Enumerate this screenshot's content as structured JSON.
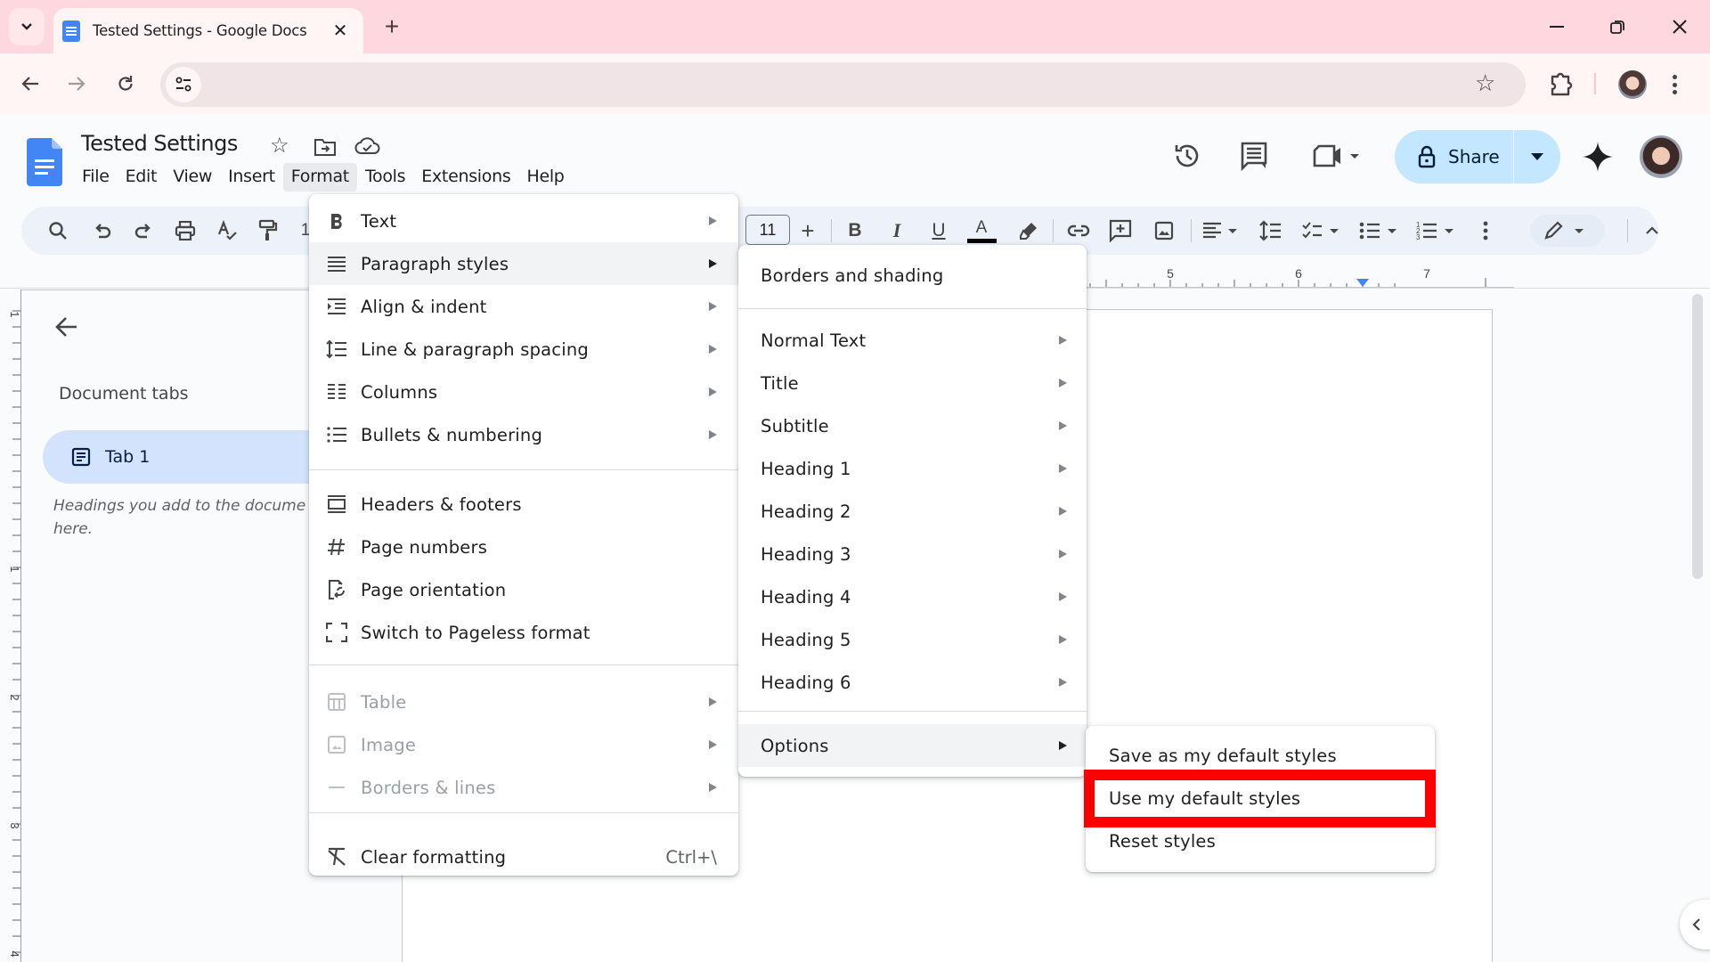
{
  "browser": {
    "tab_title": "Tested Settings - Google Docs",
    "icons": {
      "tab_search": "chevron-down-icon",
      "close_tab": "close-icon",
      "new_tab": "plus-icon",
      "minimize": "minimize-icon",
      "restore": "restore-icon",
      "close_window": "close-icon",
      "back": "arrow-left-icon",
      "forward": "arrow-right-icon",
      "reload": "reload-icon",
      "site_info": "tune-icon",
      "bookmark": "star-icon",
      "extensions": "puzzle-icon",
      "profile": "avatar",
      "menu": "more-vert-icon"
    },
    "glyphs": {
      "chevron": "⌄",
      "close": "✕",
      "plus": "+",
      "minimize": "—",
      "restore": "❐",
      "back": "←",
      "forward": "→",
      "reload": "↻",
      "star": "☆"
    },
    "address": ""
  },
  "docs": {
    "title": "Tested Settings",
    "title_glyphs": {
      "star": "☆"
    },
    "menubar": [
      "File",
      "Edit",
      "View",
      "Insert",
      "Format",
      "Tools",
      "Extensions",
      "Help"
    ],
    "active_menu": "Format",
    "header_actions": {
      "history": "history-icon",
      "comments": "comment-icon",
      "meet": "video-call-icon",
      "share_label": "Share",
      "gemini": "gemini-sparkle-icon"
    },
    "toolbar": {
      "font_size": "11",
      "partial_label": "1",
      "plus": "+",
      "bold": "B",
      "italic": "I",
      "underline": "U",
      "text_color": "A",
      "text_color_value": "#000000"
    },
    "ruler": {
      "labels": [
        "5",
        "6",
        "7"
      ]
    },
    "vertical_ruler": {
      "labels": [
        "1",
        "1",
        "2",
        "3",
        "4"
      ]
    }
  },
  "outline": {
    "heading": "Document tabs",
    "tab_label": "Tab 1",
    "hint": "Headings you add to the docume will appear here."
  },
  "format_menu": {
    "items": [
      {
        "label": "Text",
        "icon": "bold-icon",
        "glyph": "B",
        "submenu": true
      },
      {
        "label": "Paragraph styles",
        "icon": "paragraph-styles-icon",
        "submenu": true,
        "highlighted": true
      },
      {
        "label": "Align & indent",
        "icon": "indent-icon",
        "submenu": true
      },
      {
        "label": "Line & paragraph spacing",
        "icon": "line-spacing-icon",
        "submenu": true
      },
      {
        "label": "Columns",
        "icon": "columns-icon",
        "submenu": true
      },
      {
        "label": "Bullets & numbering",
        "icon": "bulleted-list-icon",
        "submenu": true
      },
      {
        "label": "Headers & footers",
        "icon": "headers-footers-icon"
      },
      {
        "label": "Page numbers",
        "icon": "hash-icon",
        "glyph": "#"
      },
      {
        "label": "Page orientation",
        "icon": "page-orientation-icon"
      },
      {
        "label": "Switch to Pageless format",
        "icon": "pageless-icon"
      },
      {
        "label": "Table",
        "icon": "table-icon",
        "submenu": true,
        "disabled": true
      },
      {
        "label": "Image",
        "icon": "image-icon",
        "submenu": true,
        "disabled": true
      },
      {
        "label": "Borders & lines",
        "icon": "horizontal-line-icon",
        "submenu": true,
        "disabled": true
      },
      {
        "label": "Clear formatting",
        "icon": "clear-formatting-icon",
        "shortcut": "Ctrl+\\"
      }
    ]
  },
  "paragraph_menu": {
    "items": [
      {
        "label": "Borders and shading"
      },
      {
        "label": "Normal Text",
        "submenu": true
      },
      {
        "label": "Title",
        "submenu": true
      },
      {
        "label": "Subtitle",
        "submenu": true
      },
      {
        "label": "Heading 1",
        "submenu": true
      },
      {
        "label": "Heading 2",
        "submenu": true
      },
      {
        "label": "Heading 3",
        "submenu": true
      },
      {
        "label": "Heading 4",
        "submenu": true
      },
      {
        "label": "Heading 5",
        "submenu": true
      },
      {
        "label": "Heading 6",
        "submenu": true
      },
      {
        "label": "Options",
        "submenu": true,
        "highlighted": true
      }
    ]
  },
  "options_menu": {
    "items": [
      {
        "label": "Save as my default styles"
      },
      {
        "label": "Use my default styles",
        "annotated": true
      },
      {
        "label": "Reset styles"
      }
    ]
  },
  "colors": {
    "tabstrip_bg": "#ffd7de",
    "toolbar_bg": "#edf2fa",
    "share_bg": "#c2e7ff",
    "active_tab_bg": "#d3e3fd",
    "docs_blue": "#4285f4",
    "annotation_red": "#ff0000"
  }
}
